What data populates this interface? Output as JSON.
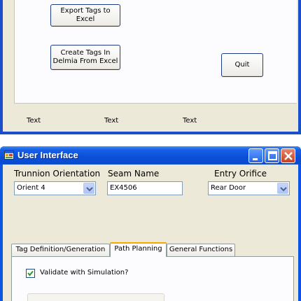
{
  "top_window": {
    "buttons": {
      "export_tags": "Export Tags to\nExcel",
      "create_tags": "Create Tags In\nDelmia From Excel",
      "quit": "Quit"
    },
    "status_texts": [
      "Text",
      "Text",
      "Text"
    ]
  },
  "window": {
    "title": "User Interface",
    "fields": {
      "trunnion_label": "Trunnion Orientation",
      "trunnion_value": "Orient 4",
      "seam_label": "Seam Name",
      "seam_value": "EX4506",
      "entry_label": "Entry Orifice",
      "entry_value": "Rear Door"
    },
    "tabs": [
      {
        "label": "Tag Definition/Generation"
      },
      {
        "label": "Path Planning"
      },
      {
        "label": "General Functions"
      }
    ],
    "active_tab": "Path Planning",
    "path_planning": {
      "validate_label": "Validate with Simulation?",
      "validate_checked": true
    }
  },
  "colors": {
    "xp_blue": "#0a55e4",
    "panel": "#ece9d8",
    "tab_accent": "#f6a800"
  }
}
